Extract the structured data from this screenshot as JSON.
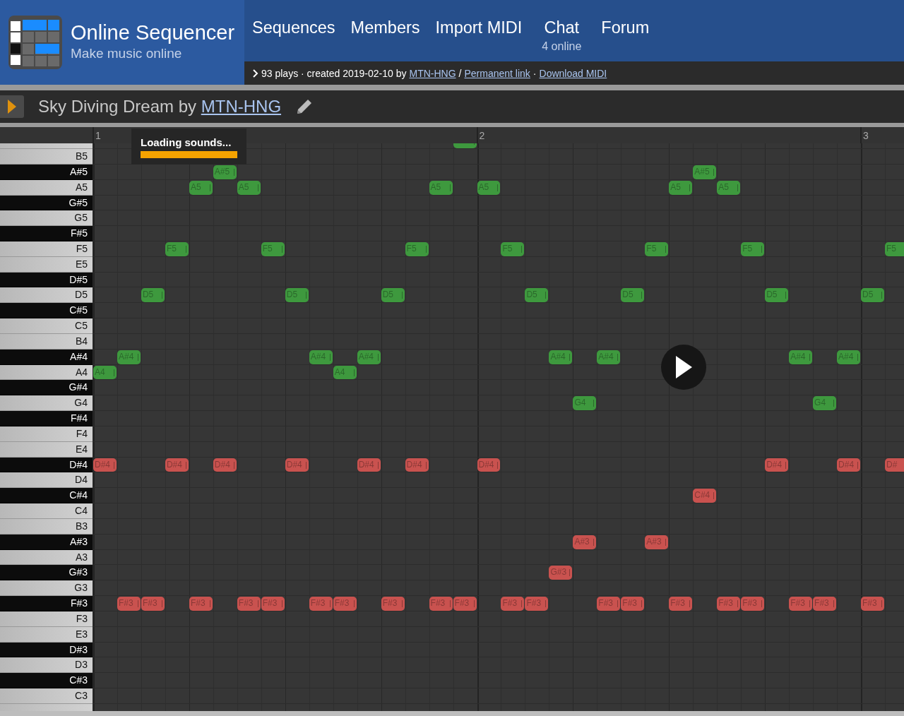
{
  "site": {
    "title": "Online Sequencer",
    "tagline": "Make music online"
  },
  "nav": [
    {
      "label": "Sequences"
    },
    {
      "label": "Members"
    },
    {
      "label": "Import MIDI"
    },
    {
      "label": "Chat",
      "sub": "4 online"
    },
    {
      "label": "Forum"
    }
  ],
  "info_bar": {
    "stats": "93 plays · created 2019-02-10 by",
    "author": "MTN-HNG",
    "sep1": "/",
    "permalink": "Permanent link",
    "sep2": "·",
    "download": "Download MIDI"
  },
  "sequence": {
    "title": "Sky Diving Dream by",
    "author": "MTN-HNG"
  },
  "bars": [
    "1",
    "2",
    "3"
  ],
  "loading": {
    "text": "Loading sounds...",
    "level": 1
  },
  "keys": [
    {
      "kind": "white",
      "slots": [
        {
          "kind": "rest"
        },
        {
          "kind": "rest"
        },
        {
          "kind": "rest"
        },
        {
          "kind": "rest"
        },
        {
          "kind": "rest"
        },
        {
          "kind": "rest"
        },
        {
          "kind": "rest"
        },
        {
          "kind": "rest"
        },
        {
          "kind": "rest"
        },
        {
          "kind": "rest"
        },
        {
          "kind": "rest"
        },
        {
          "kind": "rest"
        },
        {
          "kind": "rest"
        },
        {
          "kind": "rest"
        },
        {
          "kind": "rest"
        },
        {
          "kind": "note",
          "color": "#3e993e"
        }
      ]
    },
    {
      "label": "B5",
      "kind": "white"
    },
    {
      "label": "A#5",
      "kind": "black",
      "slots": [
        {
          "kind": "rest"
        },
        {
          "kind": "rest"
        },
        {
          "kind": "rest"
        },
        {
          "kind": "rest"
        },
        {
          "kind": "rest"
        },
        {
          "kind": "note",
          "label": "A#5",
          "color": "#3e993e"
        },
        {
          "kind": "rest"
        },
        {
          "kind": "rest"
        },
        {
          "kind": "rest"
        },
        {
          "kind": "rest"
        },
        {
          "kind": "rest"
        },
        {
          "kind": "rest"
        },
        {
          "kind": "rest"
        },
        {
          "kind": "rest"
        },
        {
          "kind": "rest"
        },
        {
          "kind": "rest"
        },
        {
          "kind": "rest"
        },
        {
          "kind": "rest"
        },
        {
          "kind": "rest"
        },
        {
          "kind": "rest"
        },
        {
          "kind": "rest"
        },
        {
          "kind": "rest"
        },
        {
          "kind": "rest"
        },
        {
          "kind": "rest"
        },
        {
          "kind": "rest"
        },
        {
          "kind": "note",
          "label": "A#5",
          "color": "#3e993e"
        }
      ]
    },
    {
      "label": "A5",
      "kind": "white",
      "slots": [
        {
          "kind": "rest"
        },
        {
          "kind": "rest"
        },
        {
          "kind": "rest"
        },
        {
          "kind": "rest"
        },
        {
          "kind": "note",
          "label": "A5",
          "color": "#3e993e"
        },
        {
          "kind": "rest"
        },
        {
          "kind": "note",
          "label": "A5",
          "color": "#3e993e"
        },
        {
          "kind": "rest"
        },
        {
          "kind": "rest"
        },
        {
          "kind": "rest"
        },
        {
          "kind": "rest"
        },
        {
          "kind": "rest"
        },
        {
          "kind": "rest"
        },
        {
          "kind": "rest"
        },
        {
          "kind": "note",
          "label": "A5",
          "color": "#3e993e"
        },
        {
          "kind": "rest"
        },
        {
          "kind": "note",
          "label": "A5",
          "color": "#3e993e"
        },
        {
          "kind": "rest"
        },
        {
          "kind": "rest"
        },
        {
          "kind": "rest"
        },
        {
          "kind": "rest"
        },
        {
          "kind": "rest"
        },
        {
          "kind": "rest"
        },
        {
          "kind": "rest"
        },
        {
          "kind": "note",
          "label": "A5",
          "color": "#3e993e"
        },
        {
          "kind": "rest"
        },
        {
          "kind": "note",
          "label": "A5",
          "color": "#3e993e"
        }
      ]
    },
    {
      "label": "G#5",
      "kind": "black"
    },
    {
      "label": "G5",
      "kind": "white"
    },
    {
      "label": "F#5",
      "kind": "black"
    },
    {
      "label": "F5",
      "kind": "white",
      "slots": [
        {
          "kind": "rest"
        },
        {
          "kind": "rest"
        },
        {
          "kind": "rest"
        },
        {
          "kind": "note",
          "label": "F5",
          "color": "#3e993e"
        },
        {
          "kind": "rest"
        },
        {
          "kind": "rest"
        },
        {
          "kind": "rest"
        },
        {
          "kind": "note",
          "label": "F5",
          "color": "#3e993e"
        },
        {
          "kind": "rest"
        },
        {
          "kind": "rest"
        },
        {
          "kind": "rest"
        },
        {
          "kind": "rest"
        },
        {
          "kind": "rest"
        },
        {
          "kind": "note",
          "label": "F5",
          "color": "#3e993e"
        },
        {
          "kind": "rest"
        },
        {
          "kind": "rest"
        },
        {
          "kind": "rest"
        },
        {
          "kind": "note",
          "label": "F5",
          "color": "#3e993e"
        },
        {
          "kind": "rest"
        },
        {
          "kind": "rest"
        },
        {
          "kind": "rest"
        },
        {
          "kind": "rest"
        },
        {
          "kind": "rest"
        },
        {
          "kind": "note",
          "label": "F5",
          "color": "#3e993e"
        },
        {
          "kind": "rest"
        },
        {
          "kind": "rest"
        },
        {
          "kind": "rest"
        },
        {
          "kind": "note",
          "label": "F5",
          "color": "#3e993e"
        },
        {
          "kind": "rest"
        },
        {
          "kind": "rest"
        },
        {
          "kind": "rest"
        },
        {
          "kind": "rest"
        },
        {
          "kind": "rest"
        },
        {
          "kind": "note",
          "label": "F5",
          "color": "#3e993e"
        }
      ]
    },
    {
      "label": "E5",
      "kind": "white"
    },
    {
      "label": "D#5",
      "kind": "black"
    },
    {
      "label": "D5",
      "kind": "white",
      "slots": [
        {
          "kind": "rest"
        },
        {
          "kind": "rest"
        },
        {
          "kind": "note",
          "label": "D5",
          "color": "#3e993e"
        },
        {
          "kind": "rest"
        },
        {
          "kind": "rest"
        },
        {
          "kind": "rest"
        },
        {
          "kind": "rest"
        },
        {
          "kind": "rest"
        },
        {
          "kind": "note",
          "label": "D5",
          "color": "#3e993e"
        },
        {
          "kind": "rest"
        },
        {
          "kind": "rest"
        },
        {
          "kind": "rest"
        },
        {
          "kind": "note",
          "label": "D5",
          "color": "#3e993e"
        },
        {
          "kind": "rest"
        },
        {
          "kind": "rest"
        },
        {
          "kind": "rest"
        },
        {
          "kind": "rest"
        },
        {
          "kind": "rest"
        },
        {
          "kind": "note",
          "label": "D5",
          "color": "#3e993e"
        },
        {
          "kind": "rest"
        },
        {
          "kind": "rest"
        },
        {
          "kind": "rest"
        },
        {
          "kind": "note",
          "label": "D5",
          "color": "#3e993e"
        },
        {
          "kind": "rest"
        },
        {
          "kind": "rest"
        },
        {
          "kind": "rest"
        },
        {
          "kind": "rest"
        },
        {
          "kind": "rest"
        },
        {
          "kind": "note",
          "label": "D5",
          "color": "#3e993e"
        },
        {
          "kind": "rest"
        },
        {
          "kind": "rest"
        },
        {
          "kind": "rest"
        },
        {
          "kind": "note",
          "label": "D5",
          "color": "#3e993e"
        }
      ]
    },
    {
      "label": "C#5",
      "kind": "black"
    },
    {
      "label": "C5",
      "kind": "white"
    },
    {
      "label": "B4",
      "kind": "white"
    },
    {
      "label": "A#4",
      "kind": "black",
      "slots": [
        {
          "kind": "rest"
        },
        {
          "kind": "note",
          "label": "A#4",
          "color": "#3e993e"
        },
        {
          "kind": "rest"
        },
        {
          "kind": "rest"
        },
        {
          "kind": "rest"
        },
        {
          "kind": "rest"
        },
        {
          "kind": "rest"
        },
        {
          "kind": "rest"
        },
        {
          "kind": "rest"
        },
        {
          "kind": "note",
          "label": "A#4",
          "color": "#3e993e"
        },
        {
          "kind": "rest"
        },
        {
          "kind": "note",
          "label": "A#4",
          "color": "#3e993e"
        },
        {
          "kind": "rest"
        },
        {
          "kind": "rest"
        },
        {
          "kind": "rest"
        },
        {
          "kind": "rest"
        },
        {
          "kind": "rest"
        },
        {
          "kind": "rest"
        },
        {
          "kind": "rest"
        },
        {
          "kind": "note",
          "label": "A#4",
          "color": "#3e993e"
        },
        {
          "kind": "rest"
        },
        {
          "kind": "note",
          "label": "A#4",
          "color": "#3e993e"
        },
        {
          "kind": "rest"
        },
        {
          "kind": "rest"
        },
        {
          "kind": "rest"
        },
        {
          "kind": "rest"
        },
        {
          "kind": "rest"
        },
        {
          "kind": "rest"
        },
        {
          "kind": "rest"
        },
        {
          "kind": "note",
          "label": "A#4",
          "color": "#3e993e"
        },
        {
          "kind": "rest"
        },
        {
          "kind": "note",
          "label": "A#4",
          "color": "#3e993e"
        }
      ]
    },
    {
      "label": "A4",
      "kind": "white",
      "slots": [
        {
          "kind": "note",
          "label": "A4",
          "color": "#3e993e"
        },
        {
          "kind": "rest"
        },
        {
          "kind": "rest"
        },
        {
          "kind": "rest"
        },
        {
          "kind": "rest"
        },
        {
          "kind": "rest"
        },
        {
          "kind": "rest"
        },
        {
          "kind": "rest"
        },
        {
          "kind": "rest"
        },
        {
          "kind": "rest"
        },
        {
          "kind": "note",
          "label": "A4",
          "color": "#3e993e"
        }
      ]
    },
    {
      "label": "G#4",
      "kind": "black"
    },
    {
      "label": "G4",
      "kind": "white",
      "slots": [
        {
          "kind": "rest"
        },
        {
          "kind": "rest"
        },
        {
          "kind": "rest"
        },
        {
          "kind": "rest"
        },
        {
          "kind": "rest"
        },
        {
          "kind": "rest"
        },
        {
          "kind": "rest"
        },
        {
          "kind": "rest"
        },
        {
          "kind": "rest"
        },
        {
          "kind": "rest"
        },
        {
          "kind": "rest"
        },
        {
          "kind": "rest"
        },
        {
          "kind": "rest"
        },
        {
          "kind": "rest"
        },
        {
          "kind": "rest"
        },
        {
          "kind": "rest"
        },
        {
          "kind": "rest"
        },
        {
          "kind": "rest"
        },
        {
          "kind": "rest"
        },
        {
          "kind": "rest"
        },
        {
          "kind": "note",
          "label": "G4",
          "color": "#3e993e"
        },
        {
          "kind": "rest"
        },
        {
          "kind": "rest"
        },
        {
          "kind": "rest"
        },
        {
          "kind": "rest"
        },
        {
          "kind": "rest"
        },
        {
          "kind": "rest"
        },
        {
          "kind": "rest"
        },
        {
          "kind": "rest"
        },
        {
          "kind": "rest"
        },
        {
          "kind": "note",
          "label": "G4",
          "color": "#3e993e"
        }
      ]
    },
    {
      "label": "F#4",
      "kind": "black"
    },
    {
      "label": "F4",
      "kind": "white"
    },
    {
      "label": "E4",
      "kind": "white"
    },
    {
      "label": "D#4",
      "kind": "black",
      "slots": [
        {
          "kind": "note",
          "label": "D#4",
          "color": "#c9524f"
        },
        {
          "kind": "rest"
        },
        {
          "kind": "rest"
        },
        {
          "kind": "note",
          "label": "D#4",
          "color": "#c9524f"
        },
        {
          "kind": "rest"
        },
        {
          "kind": "note",
          "label": "D#4",
          "color": "#c9524f"
        },
        {
          "kind": "rest"
        },
        {
          "kind": "rest"
        },
        {
          "kind": "note",
          "label": "D#4",
          "color": "#c9524f"
        },
        {
          "kind": "rest"
        },
        {
          "kind": "rest"
        },
        {
          "kind": "note",
          "label": "D#4",
          "color": "#c9524f"
        },
        {
          "kind": "rest"
        },
        {
          "kind": "note",
          "label": "D#4",
          "color": "#c9524f"
        },
        {
          "kind": "rest"
        },
        {
          "kind": "rest"
        },
        {
          "kind": "note",
          "label": "D#4",
          "color": "#c9524f"
        },
        {
          "kind": "rest"
        },
        {
          "kind": "rest"
        },
        {
          "kind": "rest"
        },
        {
          "kind": "rest"
        },
        {
          "kind": "rest"
        },
        {
          "kind": "rest"
        },
        {
          "kind": "rest"
        },
        {
          "kind": "rest"
        },
        {
          "kind": "rest"
        },
        {
          "kind": "rest"
        },
        {
          "kind": "rest"
        },
        {
          "kind": "note",
          "label": "D#4",
          "color": "#c9524f"
        },
        {
          "kind": "rest"
        },
        {
          "kind": "rest"
        },
        {
          "kind": "note",
          "label": "D#4",
          "color": "#c9524f"
        },
        {
          "kind": "rest"
        },
        {
          "kind": "note",
          "label": "D#",
          "color": "#c9524f"
        }
      ]
    },
    {
      "label": "D4",
      "kind": "white"
    },
    {
      "label": "C#4",
      "kind": "black",
      "slots": [
        {
          "kind": "rest"
        },
        {
          "kind": "rest"
        },
        {
          "kind": "rest"
        },
        {
          "kind": "rest"
        },
        {
          "kind": "rest"
        },
        {
          "kind": "rest"
        },
        {
          "kind": "rest"
        },
        {
          "kind": "rest"
        },
        {
          "kind": "rest"
        },
        {
          "kind": "rest"
        },
        {
          "kind": "rest"
        },
        {
          "kind": "rest"
        },
        {
          "kind": "rest"
        },
        {
          "kind": "rest"
        },
        {
          "kind": "rest"
        },
        {
          "kind": "rest"
        },
        {
          "kind": "rest"
        },
        {
          "kind": "rest"
        },
        {
          "kind": "rest"
        },
        {
          "kind": "rest"
        },
        {
          "kind": "rest"
        },
        {
          "kind": "rest"
        },
        {
          "kind": "rest"
        },
        {
          "kind": "rest"
        },
        {
          "kind": "rest"
        },
        {
          "kind": "note",
          "label": "C#4",
          "color": "#c9524f"
        }
      ]
    },
    {
      "label": "C4",
      "kind": "white"
    },
    {
      "label": "B3",
      "kind": "white"
    },
    {
      "label": "A#3",
      "kind": "black",
      "slots": [
        {
          "kind": "rest"
        },
        {
          "kind": "rest"
        },
        {
          "kind": "rest"
        },
        {
          "kind": "rest"
        },
        {
          "kind": "rest"
        },
        {
          "kind": "rest"
        },
        {
          "kind": "rest"
        },
        {
          "kind": "rest"
        },
        {
          "kind": "rest"
        },
        {
          "kind": "rest"
        },
        {
          "kind": "rest"
        },
        {
          "kind": "rest"
        },
        {
          "kind": "rest"
        },
        {
          "kind": "rest"
        },
        {
          "kind": "rest"
        },
        {
          "kind": "rest"
        },
        {
          "kind": "rest"
        },
        {
          "kind": "rest"
        },
        {
          "kind": "rest"
        },
        {
          "kind": "rest"
        },
        {
          "kind": "note",
          "label": "A#3",
          "color": "#c9524f"
        },
        {
          "kind": "rest"
        },
        {
          "kind": "rest"
        },
        {
          "kind": "note",
          "label": "A#3",
          "color": "#c9524f"
        }
      ]
    },
    {
      "label": "A3",
      "kind": "white"
    },
    {
      "label": "G#3",
      "kind": "black",
      "slots": [
        {
          "kind": "rest"
        },
        {
          "kind": "rest"
        },
        {
          "kind": "rest"
        },
        {
          "kind": "rest"
        },
        {
          "kind": "rest"
        },
        {
          "kind": "rest"
        },
        {
          "kind": "rest"
        },
        {
          "kind": "rest"
        },
        {
          "kind": "rest"
        },
        {
          "kind": "rest"
        },
        {
          "kind": "rest"
        },
        {
          "kind": "rest"
        },
        {
          "kind": "rest"
        },
        {
          "kind": "rest"
        },
        {
          "kind": "rest"
        },
        {
          "kind": "rest"
        },
        {
          "kind": "rest"
        },
        {
          "kind": "rest"
        },
        {
          "kind": "rest"
        },
        {
          "kind": "note",
          "label": "G#3",
          "color": "#c9524f"
        }
      ]
    },
    {
      "label": "G3",
      "kind": "white"
    },
    {
      "label": "F#3",
      "kind": "black",
      "slots": [
        {
          "kind": "rest"
        },
        {
          "kind": "note",
          "label": "F#3",
          "color": "#c9524f"
        },
        {
          "kind": "note",
          "label": "F#3",
          "color": "#c9524f"
        },
        {
          "kind": "rest"
        },
        {
          "kind": "note",
          "label": "F#3",
          "color": "#c9524f"
        },
        {
          "kind": "rest"
        },
        {
          "kind": "note",
          "label": "F#3",
          "color": "#c9524f"
        },
        {
          "kind": "note",
          "label": "F#3",
          "color": "#c9524f"
        },
        {
          "kind": "rest"
        },
        {
          "kind": "note",
          "label": "F#3",
          "color": "#c9524f"
        },
        {
          "kind": "note",
          "label": "F#3",
          "color": "#c9524f"
        },
        {
          "kind": "rest"
        },
        {
          "kind": "note",
          "label": "F#3",
          "color": "#c9524f"
        },
        {
          "kind": "rest"
        },
        {
          "kind": "note",
          "label": "F#3",
          "color": "#c9524f"
        },
        {
          "kind": "note",
          "label": "F#3",
          "color": "#c9524f"
        },
        {
          "kind": "rest"
        },
        {
          "kind": "note",
          "label": "F#3",
          "color": "#c9524f"
        },
        {
          "kind": "note",
          "label": "F#3",
          "color": "#c9524f"
        },
        {
          "kind": "rest"
        },
        {
          "kind": "rest"
        },
        {
          "kind": "note",
          "label": "F#3",
          "color": "#c9524f"
        },
        {
          "kind": "note",
          "label": "F#3",
          "color": "#c9524f"
        },
        {
          "kind": "rest"
        },
        {
          "kind": "note",
          "label": "F#3",
          "color": "#c9524f"
        },
        {
          "kind": "rest"
        },
        {
          "kind": "note",
          "label": "F#3",
          "color": "#c9524f"
        },
        {
          "kind": "note",
          "label": "F#3",
          "color": "#c9524f"
        },
        {
          "kind": "rest"
        },
        {
          "kind": "note",
          "label": "F#3",
          "color": "#c9524f"
        },
        {
          "kind": "note",
          "label": "F#3",
          "color": "#c9524f"
        },
        {
          "kind": "rest"
        },
        {
          "kind": "note",
          "label": "F#3",
          "color": "#c9524f"
        }
      ]
    },
    {
      "label": "F3",
      "kind": "white"
    },
    {
      "label": "E3",
      "kind": "white"
    },
    {
      "label": "D#3",
      "kind": "black"
    },
    {
      "label": "D3",
      "kind": "white"
    },
    {
      "label": "C#3",
      "kind": "black"
    },
    {
      "label": "C3",
      "kind": "white"
    },
    {
      "kind": "white"
    }
  ]
}
